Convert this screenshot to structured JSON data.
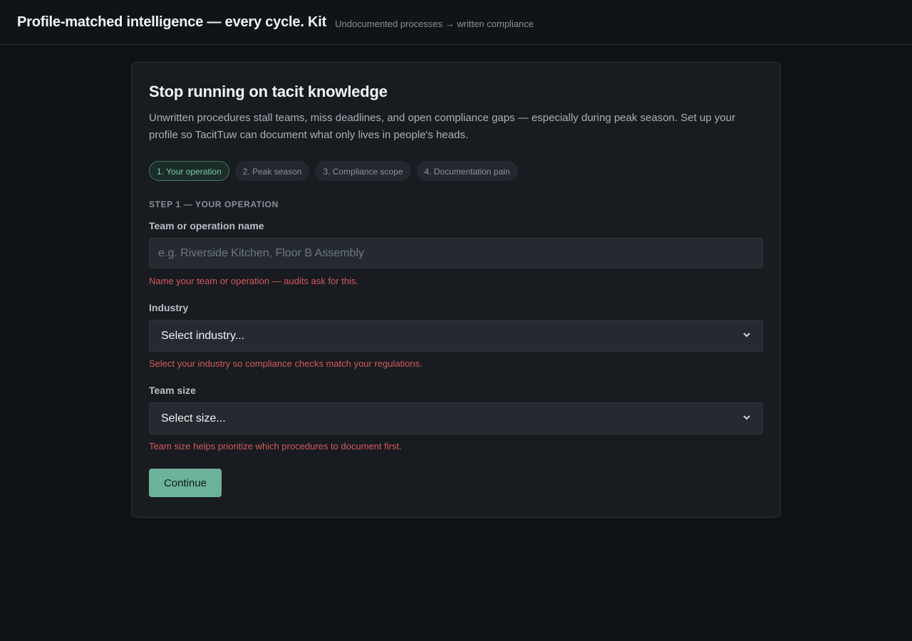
{
  "header": {
    "title": "Profile-matched intelligence — every cycle. Kit",
    "tagline": "Undocumented processes → written compliance"
  },
  "card": {
    "title": "Stop running on tacit knowledge",
    "description": "Unwritten procedures stall teams, miss deadlines, and open compliance gaps — especially during peak season. Set up your profile so TacitTuw can document what only lives in people's heads."
  },
  "steps": [
    {
      "label": "1. Your operation",
      "active": true
    },
    {
      "label": "2. Peak season",
      "active": false
    },
    {
      "label": "3. Compliance scope",
      "active": false
    },
    {
      "label": "4. Documentation pain",
      "active": false
    }
  ],
  "form": {
    "step_heading": "STEP 1 — YOUR OPERATION",
    "team_name": {
      "label": "Team or operation name",
      "value": "",
      "placeholder": "e.g. Riverside Kitchen, Floor B Assembly",
      "error": "Name your team or operation — audits ask for this."
    },
    "industry": {
      "label": "Industry",
      "selected": "Select industry...",
      "error": "Select your industry so compliance checks match your regulations."
    },
    "team_size": {
      "label": "Team size",
      "selected": "Select size...",
      "error": "Team size helps prioritize which procedures to document first."
    },
    "continue_label": "Continue"
  },
  "colors": {
    "accent": "#6cb29a",
    "error": "#d65a5a",
    "background": "#0f1215",
    "card": "#181b20"
  }
}
